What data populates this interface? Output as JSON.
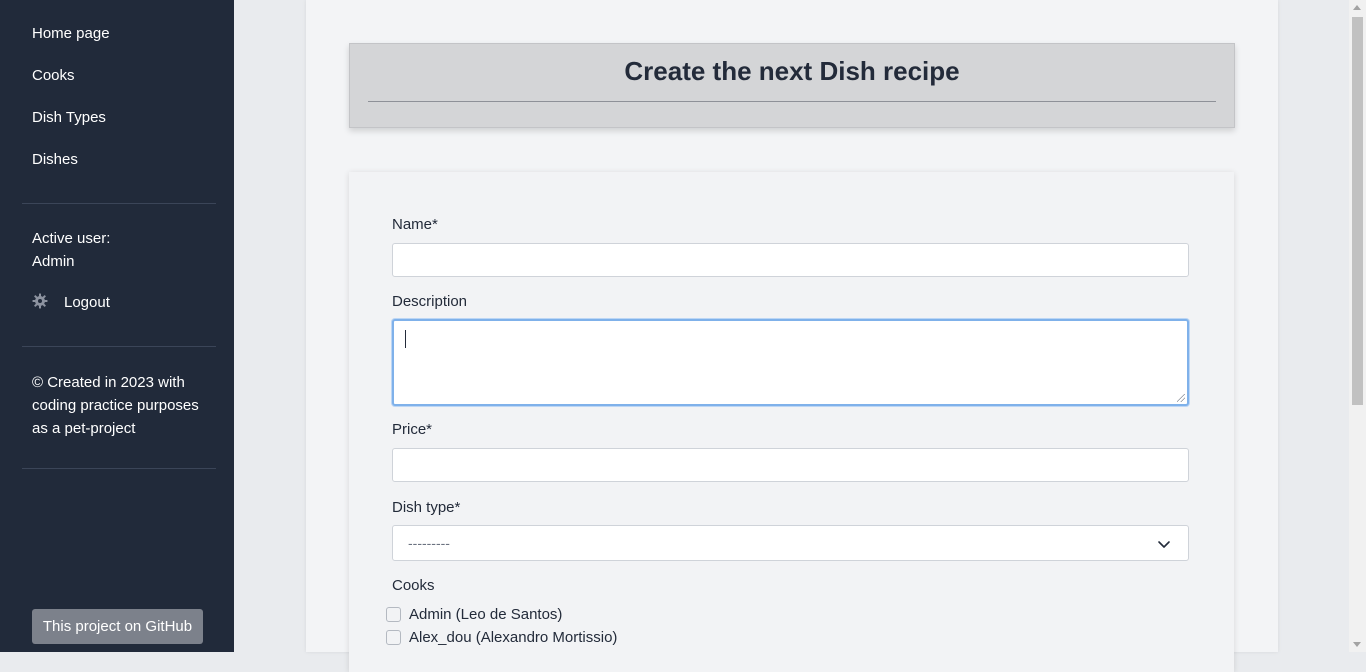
{
  "sidebar": {
    "nav": [
      {
        "label": "Home page"
      },
      {
        "label": "Cooks"
      },
      {
        "label": "Dish Types"
      },
      {
        "label": "Dishes"
      }
    ],
    "active_user_label": "Active user:",
    "active_user_name": "Admin",
    "logout_label": "Logout",
    "footer_text_1": "© Created in 2023 with",
    "footer_text_2": "coding practice purposes",
    "footer_text_3": "as a pet-project",
    "github_label": "This project on GitHub"
  },
  "page": {
    "title": "Create the next Dish recipe"
  },
  "form": {
    "name_label": "Name*",
    "name_value": "",
    "description_label": "Description",
    "description_value": "",
    "price_label": "Price*",
    "price_value": "",
    "dish_type_label": "Dish type*",
    "dish_type_selected": "---------",
    "cooks_label": "Cooks",
    "cooks": [
      {
        "label": "Admin (Leo de Santos)",
        "checked": false
      },
      {
        "label": "Alex_dou (Alexandro Mortissio)",
        "checked": false
      }
    ]
  },
  "colors": {
    "sidebar_bg": "#212a3a",
    "focus_ring": "#7fb1ea",
    "github_button": "#7c818b"
  }
}
